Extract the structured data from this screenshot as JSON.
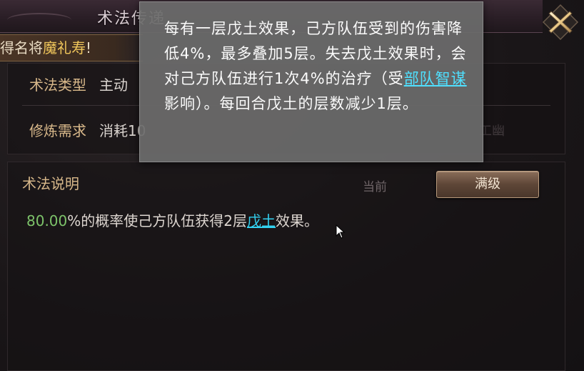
{
  "header": {
    "title": "术法传递"
  },
  "reward_banner": {
    "prefix": "得名将",
    "highlight": "魔礼寿",
    "suffix": "!"
  },
  "info": {
    "type_label": "术法类型",
    "type_value": "主动",
    "req_label": "修炼需求",
    "req_value": "消耗10",
    "faint_right": "工幽"
  },
  "description": {
    "title": "术法说明",
    "tab_current": "当前",
    "tab_max": "满级",
    "pct": "80.00",
    "text_before_link": "%的概率使己方队伍获得2层",
    "link": "戊土",
    "text_after_link": "效果。"
  },
  "tooltip": {
    "part1": "每有一层戊土效果，己方队伍受到的伤害降低4%，最多叠加5层。失去戊土效果时，会对己方队伍进行1次4%的治疗（受",
    "link": "部队智谋",
    "part2": "影响）。每回合戊土的层数减少1层。"
  },
  "colors": {
    "label_gold": "#d8b88a",
    "percent_green": "#7dc36a",
    "link_cyan": "#33d1f0",
    "reward_highlight": "#f1c75b"
  },
  "icons": {
    "close": "close-x-icon",
    "cursor": "mouse-cursor-icon"
  }
}
